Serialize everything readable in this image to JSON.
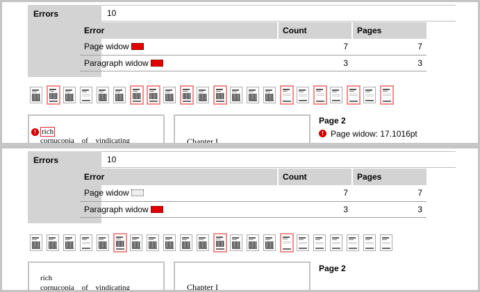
{
  "panels": [
    {
      "summary": {
        "label": "Errors",
        "count": "10"
      },
      "table": {
        "headers": [
          "Error",
          "Count",
          "Pages"
        ],
        "rows": [
          {
            "error": "Page widow",
            "count": "7",
            "pages": "7",
            "swatch": "red"
          },
          {
            "error": "Paragraph widow",
            "count": "3",
            "pages": "3",
            "swatch": "red"
          }
        ]
      },
      "preview": {
        "marker": "!",
        "word1": "rich",
        "line2": "cornucopia of vindicating evidence",
        "chapter": "Chapter I",
        "page_title": "Page 2",
        "page_item": "Page widow: 17.1016pt"
      }
    },
    {
      "summary": {
        "label": "Errors",
        "count": "10"
      },
      "table": {
        "headers": [
          "Error",
          "Count",
          "Pages"
        ],
        "rows": [
          {
            "error": "Page widow",
            "count": "7",
            "pages": "7",
            "swatch": "dotted"
          },
          {
            "error": "Paragraph widow",
            "count": "3",
            "pages": "3",
            "swatch": "red"
          }
        ]
      },
      "preview": {
        "word1": "rich",
        "line2": "cornucopia of vindicating evidence",
        "chapter": "Chapter I",
        "page_title": "Page 2"
      }
    }
  ],
  "colors": {
    "error_red": "#e00000",
    "highlight_border": "#f08c8c",
    "header_gray": "#d3d3d3"
  }
}
